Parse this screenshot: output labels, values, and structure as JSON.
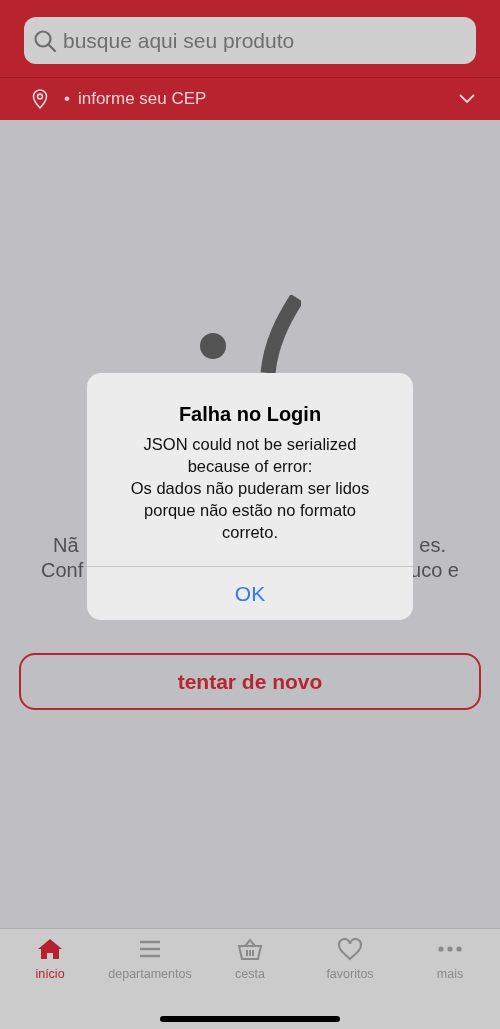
{
  "header": {
    "search": {
      "placeholder": "busque aqui seu produto"
    },
    "location": {
      "bullet": "•",
      "label": "informe seu CEP"
    }
  },
  "error_message": {
    "line_1_left": "Nã",
    "line_1_right": "es.",
    "line_2_left": "Conf",
    "line_2_right": "uco e"
  },
  "retry_button": "tentar de novo",
  "alert": {
    "title": "Falha no Login",
    "message": [
      "JSON could not be serialized",
      "because of error:",
      "Os dados não puderam ser lidos",
      "porque não estão no formato",
      "correto."
    ],
    "button": "OK"
  },
  "tab_bar": [
    {
      "kind": "home",
      "label": "início",
      "selected": true
    },
    {
      "kind": "menu",
      "label": "departamentos",
      "selected": false
    },
    {
      "kind": "basket",
      "label": "cesta",
      "selected": false
    },
    {
      "kind": "heart",
      "label": "favoritos",
      "selected": false
    },
    {
      "kind": "more",
      "label": "mais",
      "selected": false
    }
  ]
}
